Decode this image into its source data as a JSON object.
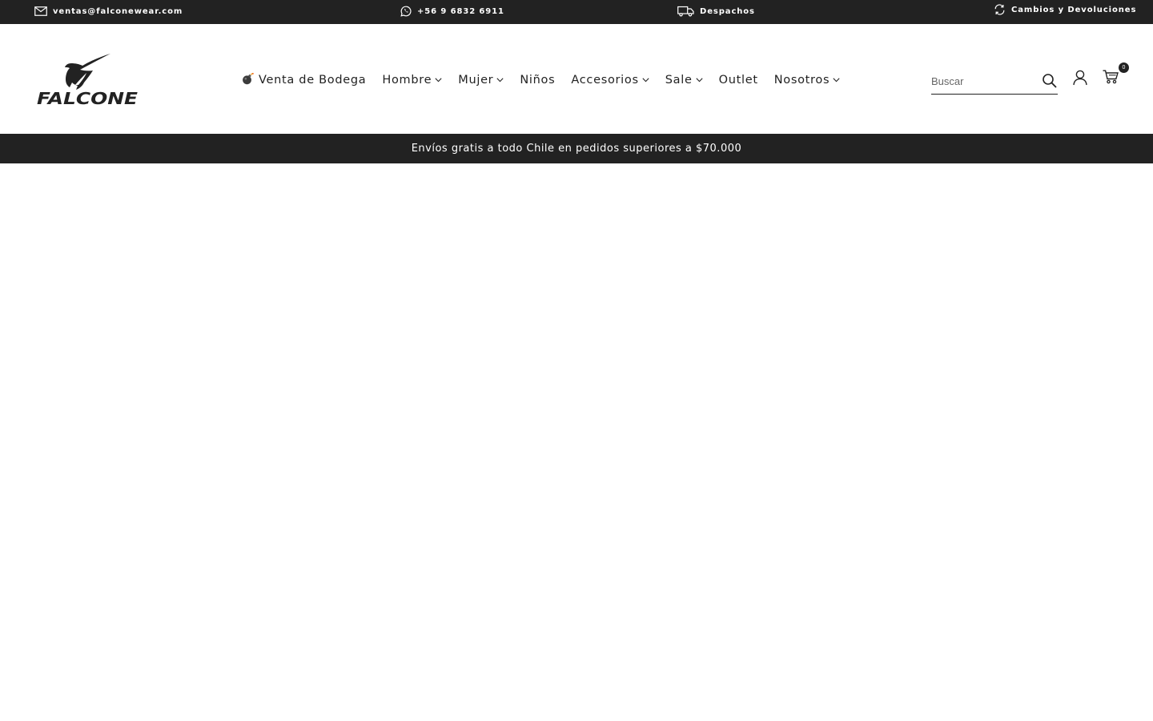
{
  "topbar": {
    "email": "ventas@falconewear.com",
    "phone": "+56 9 6832 6911",
    "shipping": "Despachos",
    "returns": "Cambios y Devoluciones",
    "icons": [
      "envelope-icon",
      "whatsapp-icon",
      "truck-icon",
      "refresh-icon"
    ]
  },
  "brand": {
    "logo_text": "FALCONE"
  },
  "nav": {
    "items": [
      {
        "label": "Venta de Bodega",
        "icon": "bomb-icon",
        "has_dropdown": false
      },
      {
        "label": "Hombre",
        "has_dropdown": true
      },
      {
        "label": "Mujer",
        "has_dropdown": true
      },
      {
        "label": "Niños",
        "has_dropdown": false
      },
      {
        "label": "Accesorios",
        "has_dropdown": true
      },
      {
        "label": "Sale",
        "has_dropdown": true
      },
      {
        "label": "Outlet",
        "has_dropdown": false
      },
      {
        "label": "Nosotros",
        "has_dropdown": true
      }
    ]
  },
  "search": {
    "placeholder": "Buscar",
    "value": ""
  },
  "cart": {
    "count": "0"
  },
  "announcement": {
    "text": "Envíos gratis a todo Chile en pedidos superiores a $70.000"
  },
  "colors": {
    "dark_bar": "#222222",
    "text": "#222222",
    "background": "#ffffff"
  }
}
